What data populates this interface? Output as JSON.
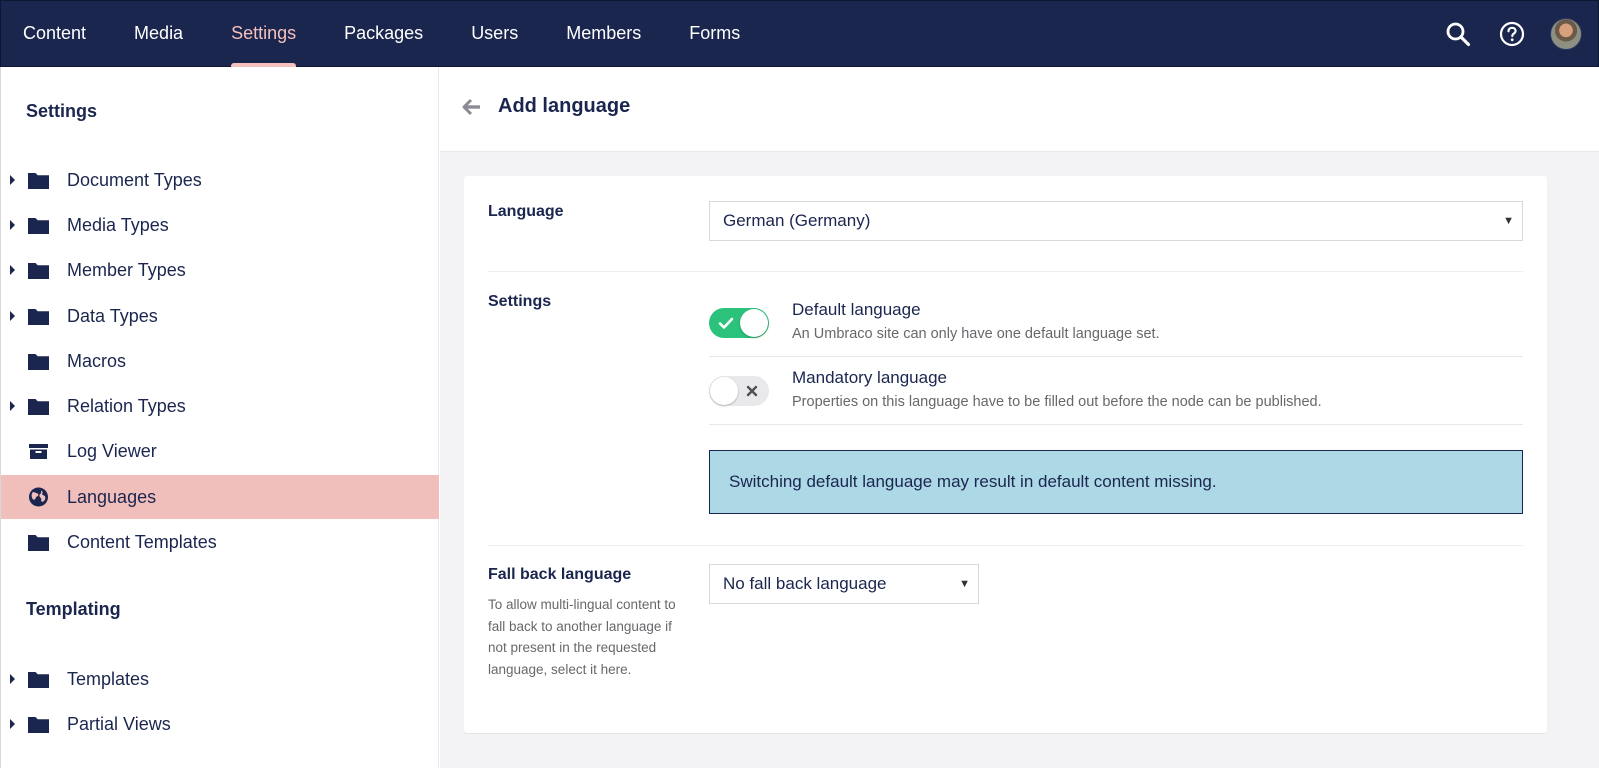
{
  "topnav": {
    "items": [
      {
        "label": "Content"
      },
      {
        "label": "Media"
      },
      {
        "label": "Settings"
      },
      {
        "label": "Packages"
      },
      {
        "label": "Users"
      },
      {
        "label": "Members"
      },
      {
        "label": "Forms"
      }
    ],
    "active_index": 2,
    "icons": [
      "search-icon",
      "help-icon",
      "user-avatar"
    ]
  },
  "sidebar": {
    "section_settings": "Settings",
    "section_templating": "Templating",
    "items": [
      {
        "label": "Document Types",
        "icon": "folder-icon",
        "expandable": true
      },
      {
        "label": "Media Types",
        "icon": "folder-icon",
        "expandable": true
      },
      {
        "label": "Member Types",
        "icon": "folder-icon",
        "expandable": true
      },
      {
        "label": "Data Types",
        "icon": "folder-icon",
        "expandable": true
      },
      {
        "label": "Macros",
        "icon": "folder-icon",
        "expandable": false
      },
      {
        "label": "Relation Types",
        "icon": "folder-icon",
        "expandable": true
      },
      {
        "label": "Log Viewer",
        "icon": "archive-icon",
        "expandable": false
      },
      {
        "label": "Languages",
        "icon": "globe-icon",
        "expandable": false,
        "active": true
      },
      {
        "label": "Content Templates",
        "icon": "folder-icon",
        "expandable": false
      }
    ],
    "templating_items": [
      {
        "label": "Templates",
        "icon": "folder-icon",
        "expandable": true
      },
      {
        "label": "Partial Views",
        "icon": "folder-icon",
        "expandable": true
      }
    ]
  },
  "header": {
    "title": "Add language"
  },
  "form": {
    "language_label": "Language",
    "language_value": "German (Germany)",
    "settings_label": "Settings",
    "default_language": {
      "title": "Default language",
      "description": "An Umbraco site can only have one default language set.",
      "enabled": true
    },
    "mandatory_language": {
      "title": "Mandatory language",
      "description": "Properties on this language have to be filled out before the node can be published.",
      "enabled": false
    },
    "alert_text": "Switching default language may result in default content missing.",
    "fallback_label": "Fall back language",
    "fallback_description": "To allow multi-lingual content to fall back to another language if not present in the requested language, select it here.",
    "fallback_value": "No fall back language"
  },
  "colors": {
    "brand_navy": "#1b264f",
    "active_pink": "#f5c1bc",
    "sidebar_active_bg": "#f0bfbb",
    "toggle_on": "#2bc37c",
    "alert_bg": "#add8e6"
  }
}
